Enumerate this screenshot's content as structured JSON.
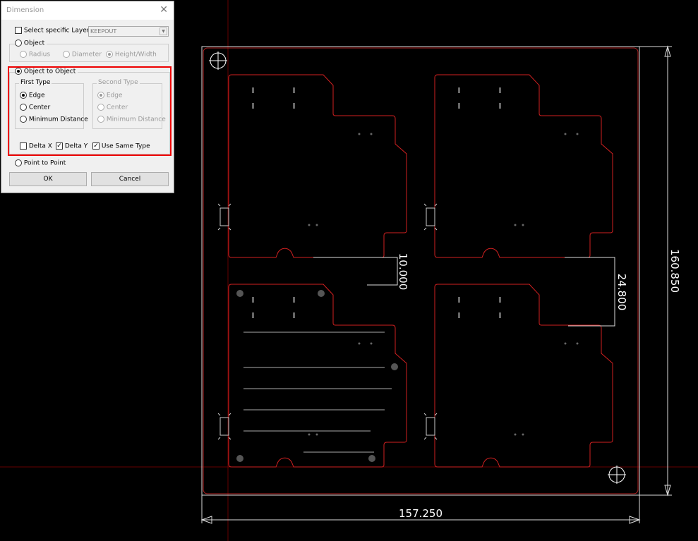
{
  "dialog": {
    "title": "Dimension",
    "select_layer": {
      "label": "Select specific Layer",
      "checked": false,
      "layer": "KEEPOUT"
    },
    "object": {
      "label": "Object",
      "selected": false,
      "options": [
        {
          "label": "Radius",
          "selected": false
        },
        {
          "label": "Diameter",
          "selected": false
        },
        {
          "label": "Height/Width",
          "selected": true
        }
      ]
    },
    "object_to_object": {
      "label": "Object to Object",
      "selected": true,
      "first_type": {
        "label": "First Type",
        "options": [
          {
            "label": "Edge",
            "selected": true
          },
          {
            "label": "Center",
            "selected": false
          },
          {
            "label": "Minimum Distance",
            "selected": false
          }
        ]
      },
      "second_type": {
        "label": "Second Type",
        "options": [
          {
            "label": "Edge",
            "selected": true
          },
          {
            "label": "Center",
            "selected": false
          },
          {
            "label": "Minimum Distance",
            "selected": false
          }
        ]
      },
      "delta_x": {
        "label": "Delta X",
        "checked": false
      },
      "delta_y": {
        "label": "Delta Y",
        "checked": true
      },
      "use_same_type": {
        "label": "Use Same Type",
        "checked": true
      }
    },
    "point_to_point": {
      "label": "Point to Point",
      "selected": false
    },
    "ok": "OK",
    "cancel": "Cancel"
  },
  "canvas": {
    "dimensions": {
      "width": "157.250",
      "height": "160.850",
      "gap_x": "10.000",
      "gap_y": "24.800"
    },
    "colors": {
      "board_outline": "#d02020",
      "dimension": "#e0e0e0",
      "background": "#000000",
      "highlight": "#e00000"
    }
  }
}
